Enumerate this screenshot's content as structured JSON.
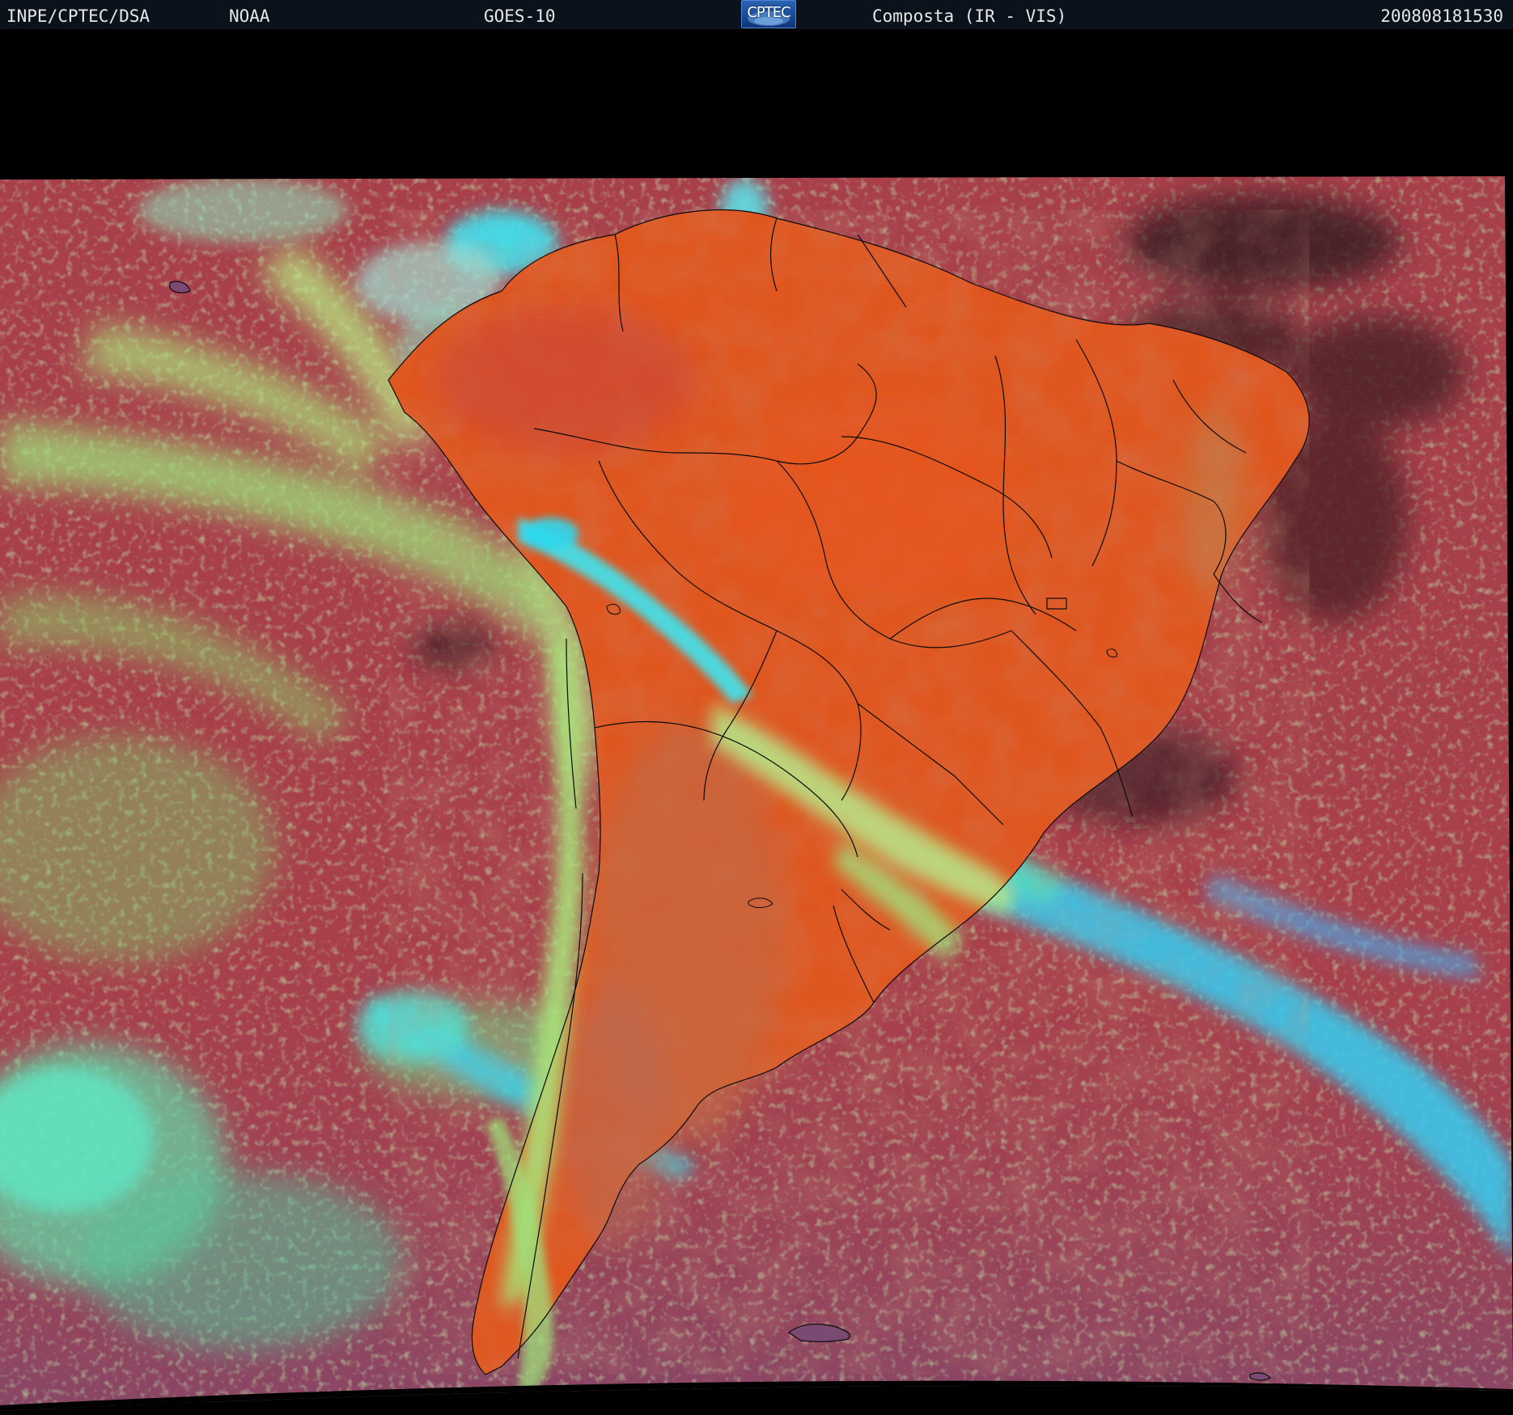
{
  "header": {
    "agency": "INPE/CPTEC/DSA",
    "org": "NOAA",
    "satellite": "GOES-10",
    "logo_text": "CPTEC",
    "product": "Composta (IR - VIS)",
    "timestamp": "200808181530"
  },
  "colors": {
    "background": "#000000",
    "header_bg": "#0a121b",
    "header_text": "#e8e8e8",
    "ocean": "#a8404c",
    "land_warm": "#e0561f",
    "land_cool": "#c96a3a",
    "low_cloud": "#8edc6a",
    "high_cloud": "#39c9e6",
    "south_ocean": "#8a4a6a",
    "borders": "#0a0a0a"
  }
}
